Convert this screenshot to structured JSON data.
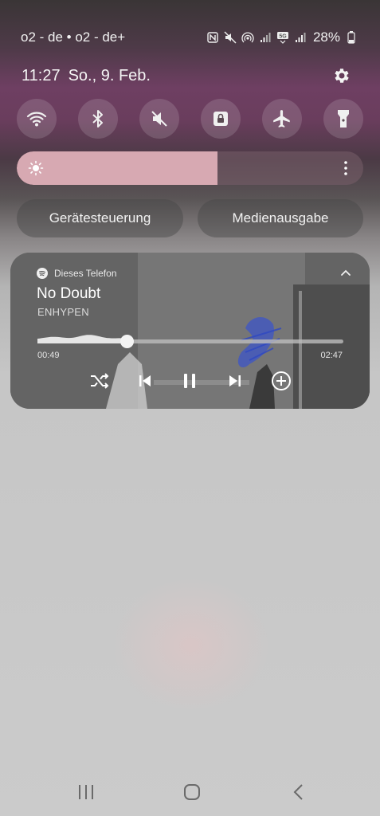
{
  "status_bar": {
    "carrier": "o2 - de • o2 - de+",
    "battery": "28%",
    "icons": [
      "nfc-icon",
      "mute-icon",
      "hotspot-icon",
      "signal-icon",
      "5g-icon",
      "signal-icon",
      "battery-icon"
    ]
  },
  "header": {
    "time": "11:27",
    "date": "So., 9. Feb.",
    "settings_icon": "gear-icon"
  },
  "quick_toggles": [
    {
      "name": "wifi",
      "icon": "wifi-icon"
    },
    {
      "name": "bluetooth",
      "icon": "bluetooth-icon"
    },
    {
      "name": "sound",
      "icon": "mute-icon"
    },
    {
      "name": "rotation-lock",
      "icon": "lock-icon"
    },
    {
      "name": "airplane-mode",
      "icon": "airplane-icon"
    },
    {
      "name": "flashlight",
      "icon": "flashlight-icon"
    }
  ],
  "brightness": {
    "level": 0.58,
    "color": "#d7a9b2"
  },
  "shortcuts": {
    "device_control": "Gerätesteuerung",
    "media_output": "Medienausgabe"
  },
  "media": {
    "source": "Dieses Telefon",
    "title": "No Doubt",
    "artist": "ENHYPEN",
    "elapsed": "00:49",
    "duration": "02:47",
    "progress": 0.293,
    "controls": [
      "shuffle-icon",
      "previous-icon",
      "pause-icon",
      "next-icon",
      "add-icon"
    ]
  }
}
